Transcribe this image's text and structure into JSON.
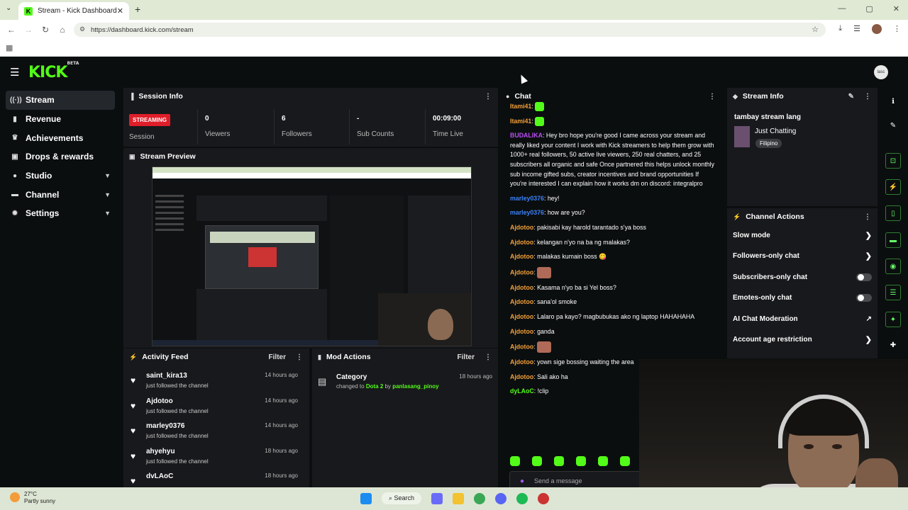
{
  "browser": {
    "tab_title": "Stream - Kick Dashboard",
    "url": "https://dashboard.kick.com/stream"
  },
  "nav": {
    "logo": "KICK",
    "logo_badge": "BETA",
    "avatar_label": "lasc"
  },
  "sidebar": {
    "items": [
      {
        "label": "Stream",
        "icon": "broadcast-icon",
        "active": true,
        "expandable": false
      },
      {
        "label": "Revenue",
        "icon": "revenue-icon",
        "active": false,
        "expandable": false
      },
      {
        "label": "Achievements",
        "icon": "trophy-icon",
        "active": false,
        "expandable": false
      },
      {
        "label": "Drops & rewards",
        "icon": "gift-icon",
        "active": false,
        "expandable": false
      },
      {
        "label": "Studio",
        "icon": "studio-icon",
        "active": false,
        "expandable": true
      },
      {
        "label": "Channel",
        "icon": "channel-icon",
        "active": false,
        "expandable": true
      },
      {
        "label": "Settings",
        "icon": "gear-icon",
        "active": false,
        "expandable": true
      }
    ]
  },
  "session": {
    "title": "Session Info",
    "status": "STREAMING",
    "session_label": "Session",
    "stats": [
      {
        "value": "0",
        "label": "Viewers"
      },
      {
        "value": "6",
        "label": "Followers"
      },
      {
        "value": "-",
        "label": "Sub Counts"
      },
      {
        "value": "00:09:00",
        "label": "Time Live"
      }
    ]
  },
  "preview": {
    "title": "Stream Preview"
  },
  "activity": {
    "title": "Activity Feed",
    "filter": "Filter",
    "items": [
      {
        "name": "saint_kira13",
        "sub": "just followed the channel",
        "time": "14 hours ago"
      },
      {
        "name": "Ajdotoo",
        "sub": "just followed the channel",
        "time": "14 hours ago"
      },
      {
        "name": "marley0376",
        "sub": "just followed the channel",
        "time": "14 hours ago"
      },
      {
        "name": "ahyehyu",
        "sub": "just followed the channel",
        "time": "18 hours ago"
      },
      {
        "name": "dvLAoC",
        "sub": "",
        "time": "18 hours ago"
      }
    ]
  },
  "mod": {
    "title": "Mod Actions",
    "filter": "Filter",
    "item": {
      "title": "Category",
      "prefix": "changed to",
      "game": "Dota 2",
      "by": "by",
      "user": "panlasang_pinoy",
      "time": "18 hours ago"
    }
  },
  "chat": {
    "title": "Chat",
    "placeholder": "Send a message",
    "messages": [
      {
        "user": "Itami41",
        "color": "or",
        "text": "",
        "emote": "green"
      },
      {
        "user": "Itami41",
        "color": "or",
        "text": "",
        "emote": "green"
      },
      {
        "user": "BUDALIKA",
        "color": "pu",
        "text": "Hey bro hope you're good I came across your stream and really liked your content I work with Kick streamers to help them grow with 1000+ real followers, 50 active live viewers, 250 real chatters, and 25 subscribers all organic and safe Once partnered this helps unlock monthly sub income gifted subs, creator incentives and brand opportunities If you're interested I can explain how it works dm on discord: integralpro",
        "emote": ""
      },
      {
        "user": "marley0376",
        "color": "bl",
        "text": "hey!",
        "emote": ""
      },
      {
        "user": "marley0376",
        "color": "bl",
        "text": "how are you?",
        "emote": ""
      },
      {
        "user": "Ajdotoo",
        "color": "or",
        "text": "pakisabi kay harold tarantado s'ya boss",
        "emote": ""
      },
      {
        "user": "Ajdotoo",
        "color": "or",
        "text": "kelangan n'yo na ba ng malakas?",
        "emote": ""
      },
      {
        "user": "Ajdotoo",
        "color": "or",
        "text": "malakas kumain boss 😋",
        "emote": ""
      },
      {
        "user": "Ajdotoo",
        "color": "or",
        "text": "",
        "emote": "face"
      },
      {
        "user": "Ajdotoo",
        "color": "or",
        "text": "Kasama n'yo ba si Yel boss?",
        "emote": ""
      },
      {
        "user": "Ajdotoo",
        "color": "or",
        "text": "sana'ol smoke",
        "emote": ""
      },
      {
        "user": "Ajdotoo",
        "color": "or",
        "text": "Lalaro pa kayo? magbubukas ako ng laptop HAHAHAHA",
        "emote": ""
      },
      {
        "user": "Ajdotoo",
        "color": "or",
        "text": "ganda",
        "emote": ""
      },
      {
        "user": "Ajdotoo",
        "color": "or",
        "text": "",
        "emote": "face"
      },
      {
        "user": "Ajdotoo",
        "color": "or",
        "text": "yown sige bossing waiting the area",
        "emote": ""
      },
      {
        "user": "Ajdotoo",
        "color": "or",
        "text": "Sali ako ha",
        "emote": ""
      },
      {
        "user": "dyLAoC",
        "color": "gr",
        "text": "!clip",
        "emote": ""
      }
    ]
  },
  "stream_info": {
    "title": "Stream Info",
    "stream_title": "tambay stream lang",
    "category": "Just Chatting",
    "tag": "Filipino"
  },
  "channel_actions": {
    "title": "Channel Actions",
    "items": [
      {
        "label": "Slow mode",
        "control": "arrow"
      },
      {
        "label": "Followers-only chat",
        "control": "arrow"
      },
      {
        "label": "Subscribers-only chat",
        "control": "toggle"
      },
      {
        "label": "Emotes-only chat",
        "control": "toggle"
      },
      {
        "label": "AI Chat Moderation",
        "control": "external"
      },
      {
        "label": "Account age restriction",
        "control": "arrow"
      }
    ]
  },
  "taskbar": {
    "temp": "27°C",
    "weather": "Partly sunny",
    "search": "Search"
  },
  "colors": {
    "accent": "#53fc18",
    "streaming": "#e01e2a",
    "panel": "#18191c"
  }
}
